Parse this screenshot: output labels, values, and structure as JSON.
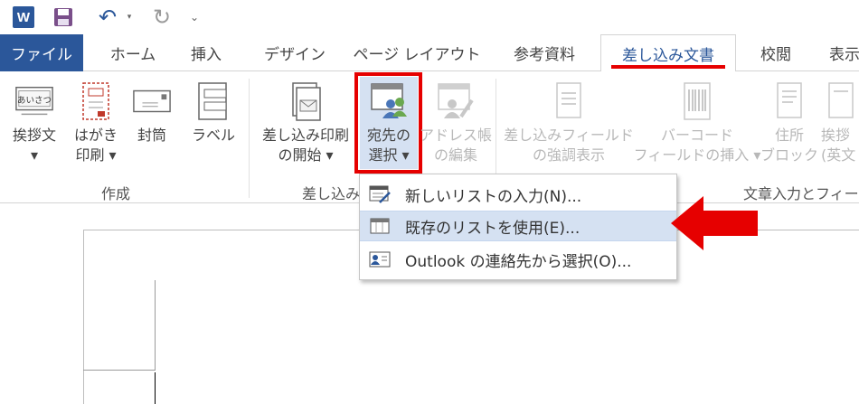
{
  "qat": {
    "app_logo": "W",
    "undo_glyph": "↶",
    "redo_glyph": "↻",
    "more_glyph": "⌄"
  },
  "tabs": [
    {
      "label": "ファイル"
    },
    {
      "label": "ホーム"
    },
    {
      "label": "挿入"
    },
    {
      "label": "デザイン"
    },
    {
      "label": "ページ レイアウト"
    },
    {
      "label": "参考資料"
    },
    {
      "label": "差し込み文書"
    },
    {
      "label": "校閲"
    },
    {
      "label": "表示"
    }
  ],
  "ribbon": {
    "create_group": {
      "label": "作成",
      "greeting": {
        "line1": "挨拶文",
        "line2": "▾",
        "icon_text": "あいさつ"
      },
      "postcard": {
        "line1": "はがき",
        "line2": "印刷 ▾"
      },
      "envelope": {
        "line1": "封筒"
      },
      "label_btn": {
        "line1": "ラベル"
      }
    },
    "start_group": {
      "label": "差し込み",
      "start_merge": {
        "line1": "差し込み印刷",
        "line2": "の開始 ▾"
      },
      "select_recipients": {
        "line1": "宛先の",
        "line2": "選択 ▾"
      },
      "edit_list": {
        "line1": "アドレス帳",
        "line2": "の編集"
      }
    },
    "write_group": {
      "label": "文章入力とフィー",
      "highlight_fields": {
        "line1": "差し込みフィールド",
        "line2": "の強調表示"
      },
      "barcode": {
        "line1": "バーコード",
        "line2": "フィールドの挿入 ▾"
      },
      "address_block": {
        "line1": "住所",
        "line2": "ブロック"
      },
      "greeting_line": {
        "line1": "挨拶",
        "line2": "(英文"
      }
    }
  },
  "dropdown": {
    "items": [
      {
        "label": "新しいリストの入力(N)..."
      },
      {
        "label": "既存のリストを使用(E)..."
      },
      {
        "label": "Outlook の連絡先から選択(O)..."
      }
    ]
  },
  "colors": {
    "accent": "#2b579a",
    "highlight_red": "#e60000",
    "hover_bg": "#d5e1f2"
  }
}
